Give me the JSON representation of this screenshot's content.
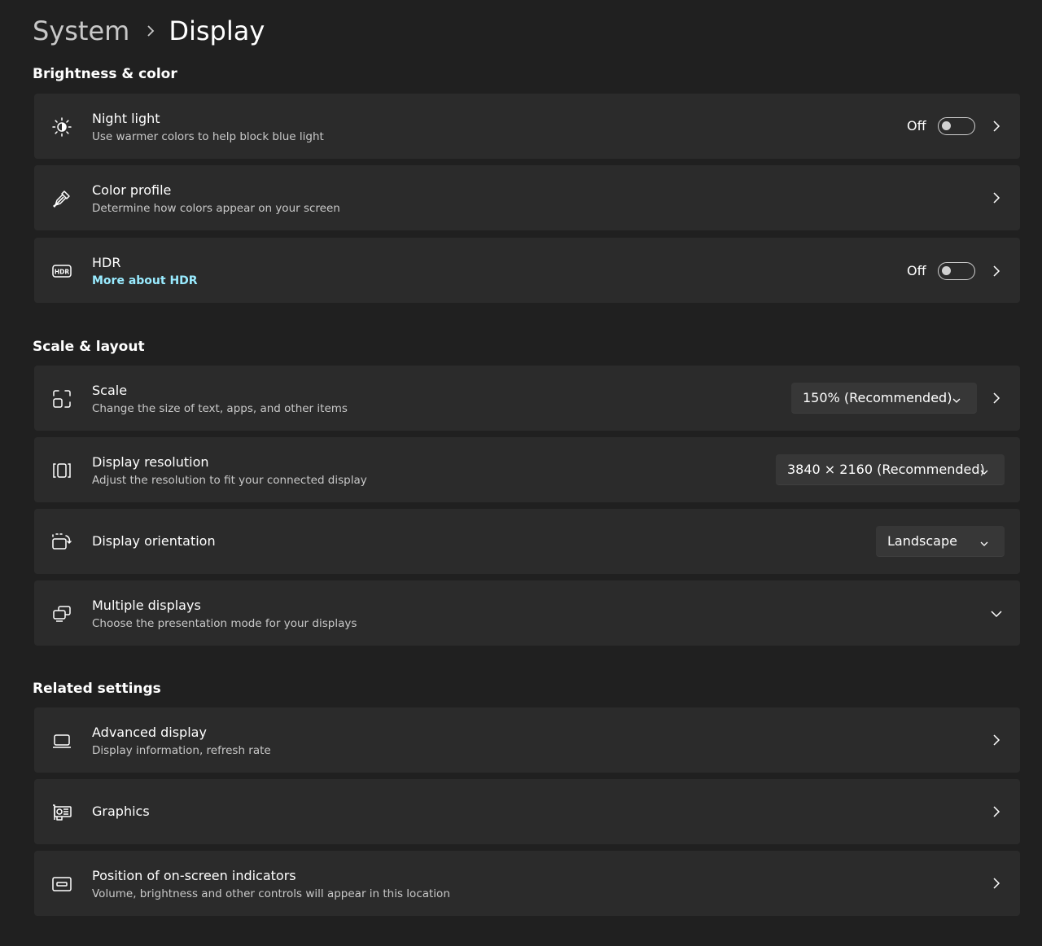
{
  "breadcrumb": {
    "parent": "System",
    "current": "Display"
  },
  "colors": {
    "background": "#202020",
    "card": "#2b2b2b",
    "accent_link": "#99ebff"
  },
  "sections": {
    "brightness": "Brightness & color",
    "scale_layout": "Scale & layout",
    "related": "Related settings"
  },
  "night_light": {
    "title": "Night light",
    "subtitle": "Use warmer colors to help block blue light",
    "state": "Off",
    "icon": "brightness-icon"
  },
  "color_profile": {
    "title": "Color profile",
    "subtitle": "Determine how colors appear on your screen",
    "icon": "eyedropper-icon"
  },
  "hdr": {
    "title": "HDR",
    "link": "More about HDR",
    "state": "Off",
    "icon": "hdr-icon"
  },
  "scale": {
    "title": "Scale",
    "subtitle": "Change the size of text, apps, and other items",
    "value": "150% (Recommended)",
    "icon": "scale-icon"
  },
  "resolution": {
    "title": "Display resolution",
    "subtitle": "Adjust the resolution to fit your connected display",
    "value": "3840 × 2160 (Recommended)",
    "icon": "resolution-icon"
  },
  "orientation": {
    "title": "Display orientation",
    "value": "Landscape",
    "icon": "rotate-display-icon"
  },
  "multiple": {
    "title": "Multiple displays",
    "subtitle": "Choose the presentation mode for your displays",
    "icon": "multiple-displays-icon"
  },
  "advanced": {
    "title": "Advanced display",
    "subtitle": "Display information, refresh rate",
    "icon": "monitor-icon"
  },
  "graphics": {
    "title": "Graphics",
    "icon": "graphics-card-icon"
  },
  "indicators": {
    "title": "Position of on-screen indicators",
    "subtitle": "Volume, brightness and other controls will appear in this location",
    "icon": "osd-position-icon"
  }
}
